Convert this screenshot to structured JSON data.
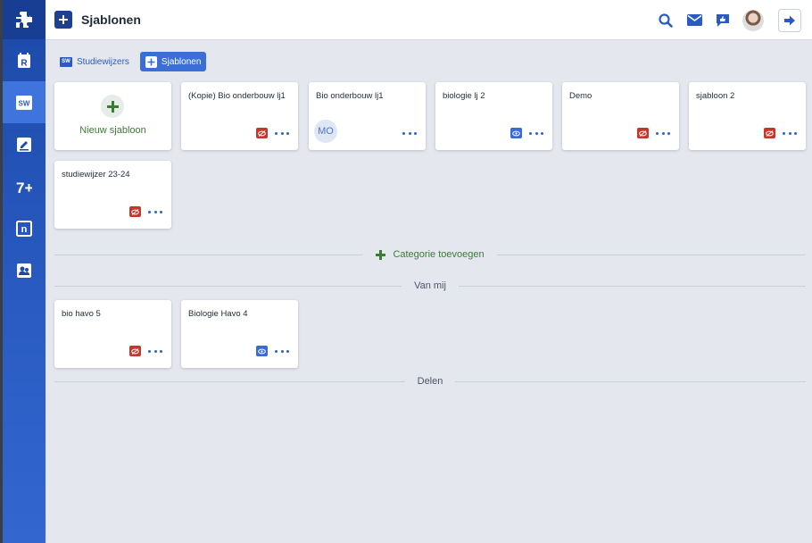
{
  "header": {
    "title": "Sjablonen"
  },
  "sidebar": {
    "items": [
      {
        "name": "rooster",
        "glyph": "R"
      },
      {
        "name": "studiewijzers",
        "glyph": "SW"
      },
      {
        "name": "inleveringen"
      },
      {
        "name": "cijfers",
        "glyph": "7+"
      },
      {
        "name": "notities",
        "glyph": "n"
      },
      {
        "name": "leerlingen"
      }
    ],
    "active_index": 1
  },
  "tabs": [
    {
      "label": "Studiewijzers",
      "active": false
    },
    {
      "label": "Sjablonen",
      "active": true
    }
  ],
  "new_template": {
    "label": "Nieuw sjabloon"
  },
  "templates": [
    {
      "name": "(Kopie) Bio onderbouw lj1",
      "visibility": "hidden"
    },
    {
      "name": "Bio onderbouw lj1",
      "owner": "MO",
      "visibility": "none"
    },
    {
      "name": "biologie lj 2",
      "visibility": "visible"
    },
    {
      "name": "Demo",
      "visibility": "hidden"
    },
    {
      "name": "sjabloon 2",
      "visibility": "hidden"
    },
    {
      "name": "studiewijzer 23-24",
      "visibility": "hidden"
    }
  ],
  "add_category": {
    "label": "Categorie toevoegen"
  },
  "categories": [
    {
      "label": "Van mij",
      "templates": [
        {
          "name": "bio havo 5",
          "visibility": "hidden"
        },
        {
          "name": "Biologie Havo 4",
          "visibility": "visible"
        }
      ]
    },
    {
      "label": "Delen",
      "templates": []
    }
  ],
  "colors": {
    "brand": "#1d4aa8",
    "accent": "#3b6fd6",
    "hidden": "#c7362b",
    "visible": "#3a6bd1",
    "add": "#3d7a36"
  },
  "icons": [
    "search-icon",
    "mail-icon",
    "feedback-icon",
    "avatar",
    "logout-icon",
    "eye-slash-icon",
    "eye-icon",
    "more-icon",
    "plus-icon"
  ]
}
